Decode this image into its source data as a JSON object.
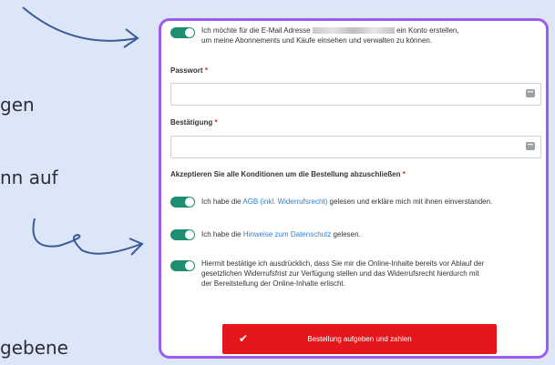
{
  "background_text": {
    "line1": "gen",
    "line2": "nn auf",
    "line3": "gebene"
  },
  "account": {
    "text_before": "Ich möchte für die E-Mail Adresse",
    "text_after": "ein Konto erstellen,",
    "line2": "um meine Abonnements und Käufe einsehen und verwalten zu können."
  },
  "password": {
    "label": "Passwort",
    "required": "*",
    "icon": "dots-icon"
  },
  "confirmation": {
    "label": "Bestätigung",
    "required": "*",
    "icon": "dots-icon"
  },
  "conditions": {
    "heading": "Akzeptieren Sie alle Konditionen um die Bestellung abzuschließen",
    "required": "*"
  },
  "agb": {
    "before": "Ich habe die",
    "link": "AGB (inkl. Widerrufsrecht)",
    "after": "gelesen und erkläre mich mit ihnen einverstanden."
  },
  "privacy": {
    "before": "Ich habe die",
    "link": "Hinweise zum Datenschutz",
    "after": "gelesen."
  },
  "withdrawal": {
    "line1": "Hiermit bestätige ich ausdrücklich, dass Sie mir die Online-Inhalte bereits vor Ablauf der",
    "line2": "gesetzlichen Widerrufsfrist zur Verfügung stellen und das Widerrufsrecht hierdurch mit",
    "line3": "der Bereitstellung der Online-Inhalte erlischt."
  },
  "submit": {
    "label": "Bestellung aufgeben und zahlen",
    "icon": "check-icon"
  },
  "colors": {
    "accent": "#1e8f70",
    "button": "#e5171c",
    "border": "#9b5cf0",
    "link": "#2a7fd4"
  }
}
